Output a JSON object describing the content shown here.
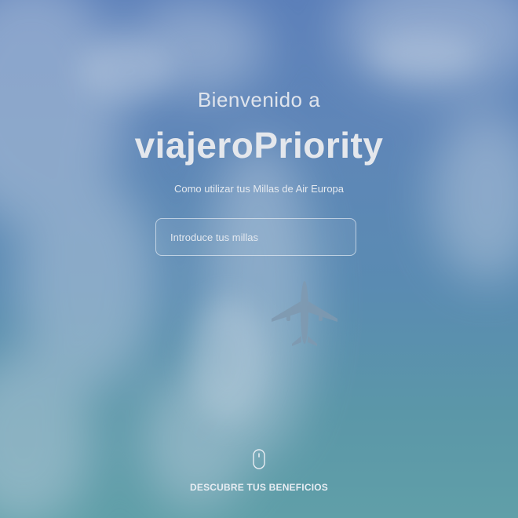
{
  "hero": {
    "welcome": "Bienvenido a",
    "brand": "viajeroPriority",
    "subtitle": "Como utilizar tus Millas de Air Europa",
    "miles_input": {
      "value": "",
      "placeholder": "Introduce tus millas"
    },
    "scroll_cta": {
      "label": "DESCUBRE TUS BENEFICIOS",
      "icon": "mouse-icon"
    },
    "background_icon": "airplane-icon"
  },
  "colors": {
    "sky_top": "#5b7fb9",
    "sky_bottom": "#609fa8",
    "text": "#e4e7ec"
  }
}
